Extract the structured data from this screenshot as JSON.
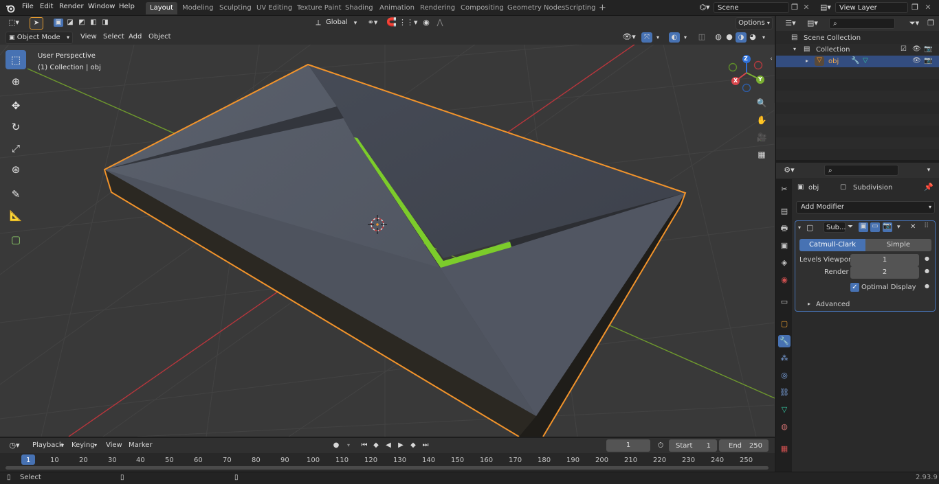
{
  "topbar": {
    "menus": [
      "File",
      "Edit",
      "Render",
      "Window",
      "Help"
    ],
    "workspaces": [
      "Layout",
      "Modeling",
      "Sculpting",
      "UV Editing",
      "Texture Paint",
      "Shading",
      "Animation",
      "Rendering",
      "Compositing",
      "Geometry Nodes",
      "Scripting"
    ],
    "active_workspace": "Layout",
    "add_tab": "+",
    "scene": "Scene",
    "view_layer": "View Layer"
  },
  "viewport_header": {
    "mode": "Object Mode",
    "menus": [
      "View",
      "Select",
      "Add",
      "Object"
    ],
    "orientation": "Global",
    "options": "Options"
  },
  "viewport": {
    "perspective": "User Perspective",
    "collection_info": "(1) Collection | obj",
    "gizmo": {
      "x": "X",
      "y": "Y",
      "z": "Z"
    },
    "colors": {
      "selection_outline": "#f3942b",
      "active_edge": "#7ccc2b",
      "background": "#393939",
      "x_axis": "#b9363c",
      "y_axis": "#6f9a2d"
    }
  },
  "outliner": {
    "scene_collection": "Scene Collection",
    "collection": "Collection",
    "object": "obj"
  },
  "properties": {
    "breadcrumb_object": "obj",
    "breadcrumb_modifier": "Subdivision",
    "add_modifier": "Add Modifier",
    "modifier_name": "Sub...",
    "type_catmull": "Catmull-Clark",
    "type_simple": "Simple",
    "levels_viewport_label": "Levels Viewport",
    "levels_viewport_value": "1",
    "render_label": "Render",
    "render_value": "2",
    "optimal_display": "Optimal Display",
    "advanced": "Advanced"
  },
  "timeline": {
    "menus": [
      "Playback",
      "Keying",
      "View",
      "Marker"
    ],
    "current_frame": "1",
    "start_label": "Start",
    "start_value": "1",
    "end_label": "End",
    "end_value": "250",
    "ticks": [
      "1",
      "10",
      "20",
      "30",
      "40",
      "50",
      "60",
      "70",
      "80",
      "90",
      "100",
      "110",
      "120",
      "130",
      "140",
      "150",
      "160",
      "170",
      "180",
      "190",
      "200",
      "210",
      "220",
      "230",
      "240",
      "250"
    ]
  },
  "statusbar": {
    "select": "Select",
    "version": "2.93.9"
  }
}
